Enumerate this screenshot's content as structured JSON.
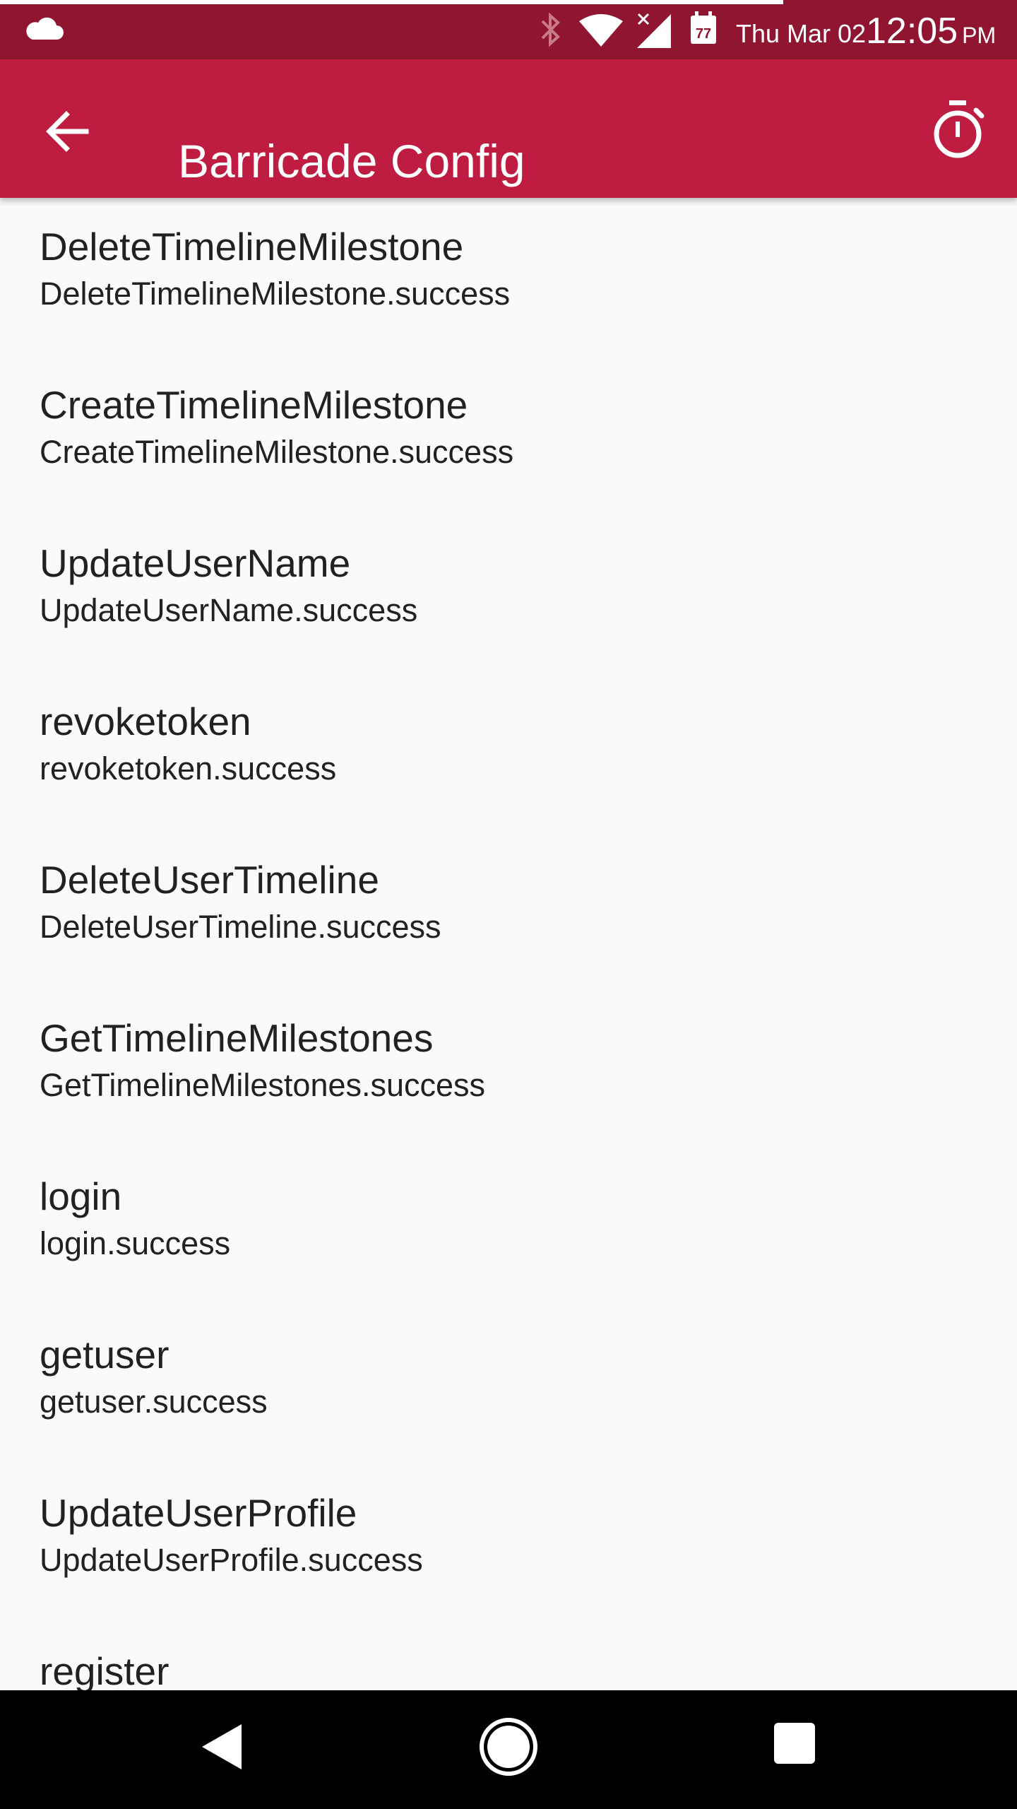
{
  "status_bar": {
    "date": "Thu Mar 02",
    "time": "12:05",
    "ampm": "PM",
    "calendar_day": "77",
    "progress": 0.77,
    "background": "#8f1530"
  },
  "app_bar": {
    "title": "Barricade Config",
    "background": "#be1c40",
    "icons": [
      "back-arrow-icon",
      "timer-icon"
    ]
  },
  "list": {
    "items": [
      {
        "title": "DeleteTimelineMilestone",
        "subtitle": "DeleteTimelineMilestone.success"
      },
      {
        "title": "CreateTimelineMilestone",
        "subtitle": "CreateTimelineMilestone.success"
      },
      {
        "title": "UpdateUserName",
        "subtitle": "UpdateUserName.success"
      },
      {
        "title": "revoketoken",
        "subtitle": "revoketoken.success"
      },
      {
        "title": "DeleteUserTimeline",
        "subtitle": "DeleteUserTimeline.success"
      },
      {
        "title": "GetTimelineMilestones",
        "subtitle": "GetTimelineMilestones.success"
      },
      {
        "title": "login",
        "subtitle": "login.success"
      },
      {
        "title": "getuser",
        "subtitle": "getuser.success"
      },
      {
        "title": "UpdateUserProfile",
        "subtitle": "UpdateUserProfile.success"
      },
      {
        "title": "register",
        "subtitle": ""
      }
    ]
  },
  "nav_bar": {
    "icons": [
      "nav-back-icon",
      "nav-home-icon",
      "nav-recents-icon"
    ]
  }
}
